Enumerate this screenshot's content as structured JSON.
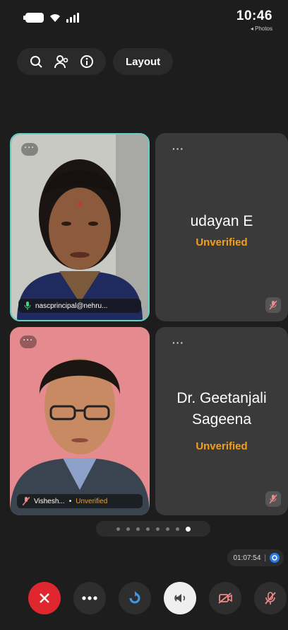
{
  "status_bar": {
    "time": "10:46",
    "back_link": "◂ Photos"
  },
  "toolbar": {
    "layout_label": "Layout",
    "icons": [
      "search-icon",
      "participants-icon",
      "info-icon"
    ]
  },
  "tiles": [
    {
      "name": "udayan E",
      "status": "Unverified",
      "more": "···",
      "muted": true
    },
    {
      "name": "Dr. Geetanjali Sageena",
      "status": "Unverified",
      "more": "···",
      "muted": true
    }
  ],
  "video_tiles": [
    {
      "caption": "nascprincipal@nehru...",
      "mic": "on",
      "border_color": "#66d0c0",
      "more": "···"
    },
    {
      "caption": "Vishesh...",
      "separator": "•",
      "status": "Unverified",
      "mic": "muted",
      "more": "···"
    }
  ],
  "pager": {
    "pages": 8,
    "active_index": 7
  },
  "timer": {
    "elapsed": "01:07:54"
  },
  "controls": [
    "hang-up-button",
    "more-options-button",
    "rotate-camera-button",
    "speaker-button",
    "video-off-button",
    "mic-off-button"
  ],
  "colors": {
    "accent_unverified": "#f0a020",
    "hangup": "#e0262e",
    "record": "#2d7be5",
    "active_speaker_border": "#66d0c0"
  }
}
